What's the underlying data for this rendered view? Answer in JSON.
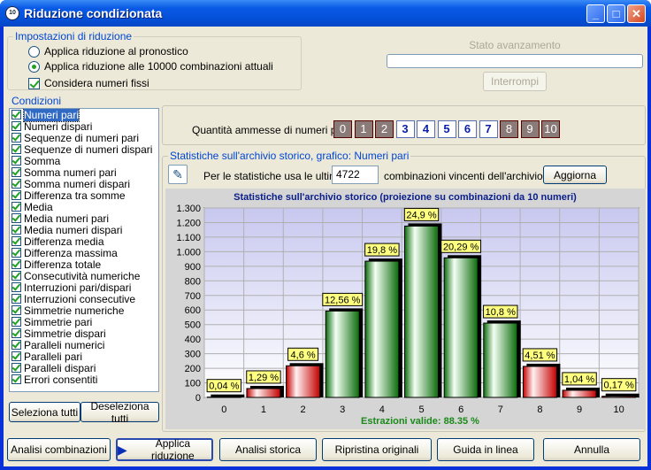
{
  "window": {
    "title": "Riduzione condizionata",
    "icon": "10-icon"
  },
  "settings": {
    "legend": "Impostazioni di riduzione",
    "radio1": "Applica riduzione al pronostico",
    "radio2": "Applica riduzione alle 10000 combinazioni attuali",
    "check": "Considera numeri fissi"
  },
  "progress": {
    "label": "Stato avanzamento",
    "stop_button": "Interrompi",
    "value": 0
  },
  "conditions": {
    "legend": "Condizioni",
    "items": [
      "Numeri pari",
      "Numeri dispari",
      "Sequenze di numeri pari",
      "Sequenze di numeri dispari",
      "Somma",
      "Somma numeri pari",
      "Somma numeri dispari",
      "Differenza tra somme",
      "Media",
      "Media numeri pari",
      "Media numeri dispari",
      "Differenza media",
      "Differenza massima",
      "Differenza totale",
      "Consecutività numeriche",
      "Interruzioni pari/dispari",
      "Interruzioni consecutive",
      "Simmetrie numeriche",
      "Simmetrie pari",
      "Simmetrie dispari",
      "Paralleli numerici",
      "Paralleli pari",
      "Paralleli dispari",
      "Errori consentiti"
    ],
    "select_all": "Seleziona tutti",
    "deselect_all": "Deseleziona tutti"
  },
  "quantity": {
    "label": "Quantità ammesse di numeri pari:",
    "cells": [
      "0",
      "1",
      "2",
      "3",
      "4",
      "5",
      "6",
      "7",
      "8",
      "9",
      "10"
    ],
    "active": [
      false,
      false,
      false,
      true,
      true,
      true,
      true,
      true,
      false,
      false,
      false
    ]
  },
  "stats": {
    "legend": "Statistiche sull'archivio storico, grafico: Numeri pari",
    "prefix": "Per le statistiche usa le ultime",
    "value": "4722",
    "suffix": "combinazioni vincenti dell'archivio",
    "update_button": "Aggiorna"
  },
  "chart_data": {
    "type": "bar",
    "title": "Statistiche sull'archivio storico (proiezione su combinazioni da 10 numeri)",
    "categories": [
      "0",
      "1",
      "2",
      "3",
      "4",
      "5",
      "6",
      "7",
      "8",
      "9",
      "10"
    ],
    "values": [
      2,
      61,
      217,
      593,
      935,
      1176,
      958,
      510,
      213,
      49,
      8
    ],
    "labels": [
      "0,04 %",
      "1,29 %",
      "4,6 %",
      "12,56 %",
      "19,8 %",
      "24,9 %",
      "20,29 %",
      "10,8 %",
      "4,51 %",
      "1,04 %",
      "0,17 %"
    ],
    "highlight": [
      false,
      false,
      false,
      true,
      true,
      true,
      true,
      true,
      false,
      false,
      false
    ],
    "yticks": [
      "0",
      "100",
      "200",
      "300",
      "400",
      "500",
      "600",
      "700",
      "800",
      "900",
      "1.000",
      "1.100",
      "1.200",
      "1.300"
    ],
    "ylim": [
      0,
      1300
    ],
    "grid": true,
    "footer": "Estrazioni valide: 88.35 %",
    "colors": {
      "green": "#1a8a1a",
      "red": "#e01818",
      "label_bg": "#ffff80"
    }
  },
  "footer": {
    "analisi_combinazioni": "Analisi combinazioni",
    "applica": "Applica riduzione",
    "analisi_storica": "Analisi storica",
    "ripristina": "Ripristina originali",
    "guida": "Guida in linea",
    "annulla": "Annulla"
  }
}
